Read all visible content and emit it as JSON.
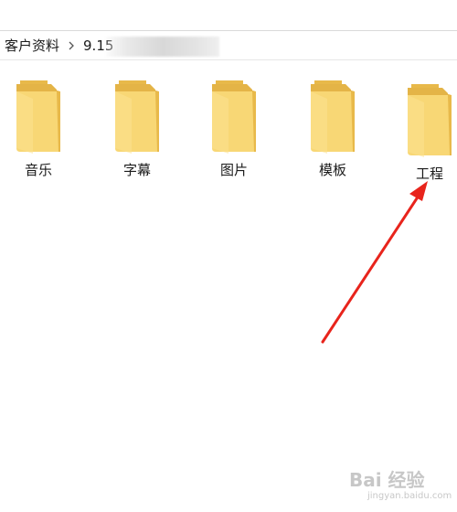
{
  "breadcrumb": {
    "root": "客户资料",
    "current": "9.15"
  },
  "folders": [
    {
      "label": "音乐",
      "icon": "folder-icon"
    },
    {
      "label": "字幕",
      "icon": "folder-icon"
    },
    {
      "label": "图片",
      "icon": "folder-icon"
    },
    {
      "label": "模板",
      "icon": "folder-icon"
    },
    {
      "label": "工程",
      "icon": "folder-icon"
    }
  ],
  "colors": {
    "folder_front": "#f8d775",
    "folder_back": "#e8b94a",
    "arrow": "#e8241c",
    "text": "#1a1a1a"
  },
  "watermark": {
    "brand": "Bai 经验",
    "url": "jingyan.baidu.com"
  }
}
